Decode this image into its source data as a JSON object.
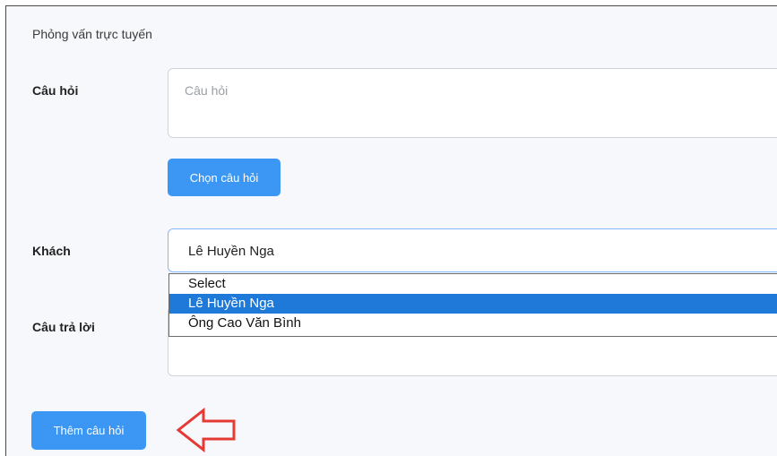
{
  "form": {
    "section_title": "Phỏng vấn trực tuyến",
    "question": {
      "label": "Câu hỏi",
      "placeholder": "Câu hỏi",
      "choose_button": "Chọn câu hỏi"
    },
    "guest": {
      "label": "Khách",
      "selected_value": "Lê Huyền Nga",
      "options": [
        "Select",
        "Lê Huyền Nga",
        "Ông Cao Văn Bình"
      ],
      "highlighted_option": "Lê Huyền Nga"
    },
    "answer": {
      "label": "Câu trả lời"
    },
    "add_button": "Thêm câu hỏi"
  },
  "colors": {
    "button": "#3b97f3",
    "highlight": "#1e79d9",
    "arrow": "#e53935"
  },
  "icons": {
    "annotation": "left-arrow-icon"
  }
}
